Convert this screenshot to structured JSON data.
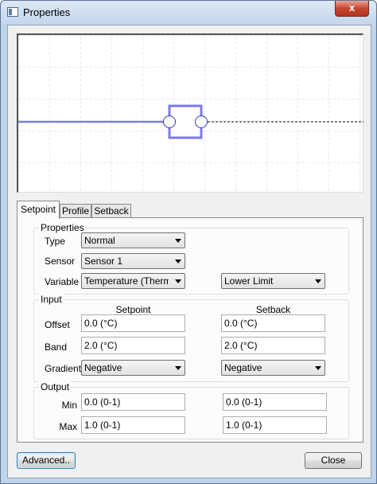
{
  "window": {
    "title": "Properties",
    "close_glyph": "x"
  },
  "tabs": [
    {
      "label": "Setpoint"
    },
    {
      "label": "Profile"
    },
    {
      "label": "Setback"
    }
  ],
  "properties": {
    "title": "Properties",
    "type_label": "Type",
    "type_value": "Normal",
    "sensor_label": "Sensor",
    "sensor_value": "Sensor 1",
    "variable_label": "Variable",
    "variable_value": "Temperature (Thermos",
    "limit_value": "Lower Limit"
  },
  "input": {
    "title": "Input",
    "col_setpoint": "Setpoint",
    "col_setback": "Setback",
    "offset_label": "Offset",
    "offset_setpoint": "0.0 (°C)",
    "offset_setback": "0.0 (°C)",
    "band_label": "Band",
    "band_setpoint": "2.0 (°C)",
    "band_setback": "2.0 (°C)",
    "gradient_label": "Gradient",
    "gradient_setpoint": "Negative",
    "gradient_setback": "Negative"
  },
  "output": {
    "title": "Output",
    "min_label": "Min",
    "min_setpoint": "0.0 (0-1)",
    "min_setback": "0.0 (0-1)",
    "max_label": "Max",
    "max_setpoint": "1.0 (0-1)",
    "max_setback": "1.0 (0-1)"
  },
  "buttons": {
    "advanced": "Advanced..",
    "close": "Close"
  },
  "colors": {
    "wire": "#7b7be8",
    "node_border": "#7b7be8",
    "grid": "#c8cdee"
  }
}
